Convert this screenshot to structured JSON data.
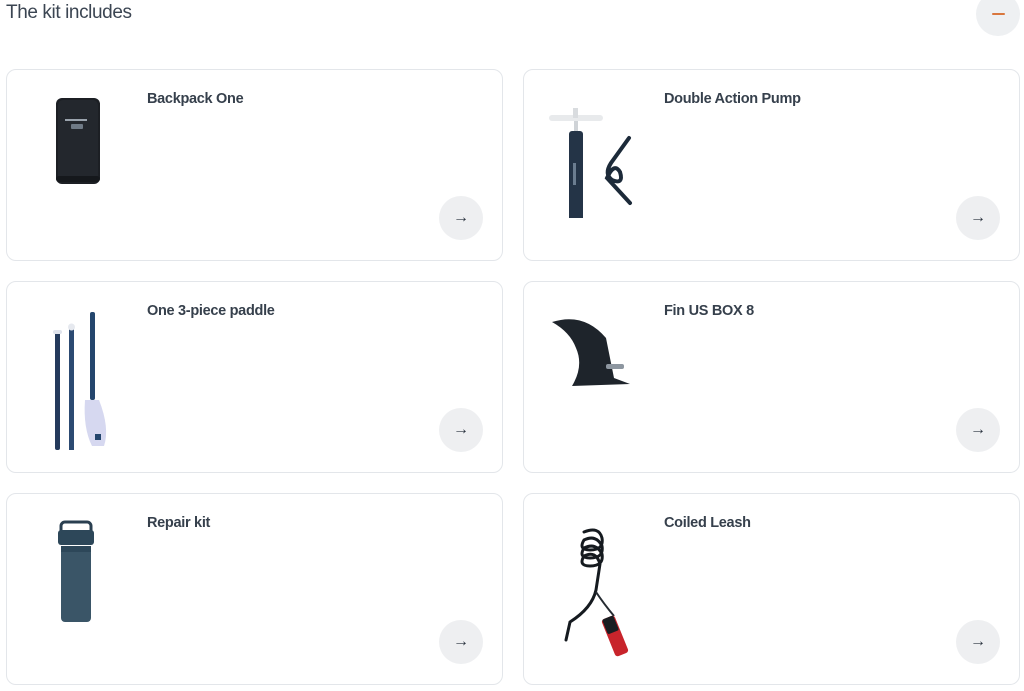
{
  "section": {
    "title": "The kit includes",
    "collapse_icon": "minus-icon",
    "accent_color": "#d9773e"
  },
  "items": [
    {
      "name": "Backpack One",
      "icon": "backpack-image",
      "arrow": "→"
    },
    {
      "name": "Double Action Pump",
      "icon": "pump-image",
      "arrow": "→"
    },
    {
      "name": "One 3-piece paddle",
      "icon": "paddle-image",
      "arrow": "→"
    },
    {
      "name": "Fin US BOX 8",
      "icon": "fin-image",
      "arrow": "→"
    },
    {
      "name": "Repair kit",
      "icon": "repair-kit-image",
      "arrow": "→"
    },
    {
      "name": "Coiled Leash",
      "icon": "leash-image",
      "arrow": "→"
    }
  ]
}
